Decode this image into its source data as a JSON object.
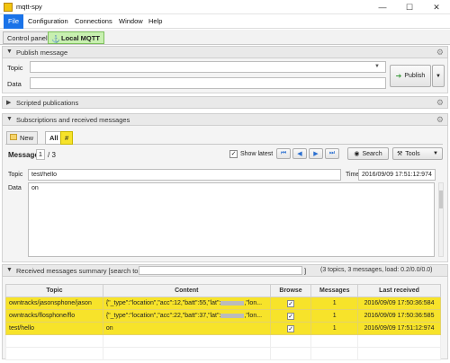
{
  "window": {
    "title": "mqtt-spy"
  },
  "menu": [
    "File",
    "Configuration",
    "Connections",
    "Window",
    "Help"
  ],
  "tabs": [
    {
      "label": "Control panel"
    },
    {
      "label": "Local MQTT"
    }
  ],
  "publish": {
    "section_title": "Publish message",
    "topic_label": "Topic",
    "data_label": "Data",
    "topic_value": "",
    "data_value": "",
    "publish_button": "Publish"
  },
  "scripted": {
    "section_title": "Scripted publications"
  },
  "subscriptions": {
    "section_title": "Subscriptions and received messages",
    "sub_tabs": [
      "New",
      "All",
      "#"
    ],
    "message_label": "Message",
    "message_index": "1",
    "message_total": "/ 3",
    "show_latest_label": "Show latest",
    "search_button": "Search",
    "tools_button": "Tools",
    "topic_label": "Topic",
    "topic_value": "test/hello",
    "time_label": "Time",
    "time_value": "2016/09/09 17:51:12:974",
    "data_label": "Data",
    "data_value": "on"
  },
  "summary": {
    "section_title": "Received messages summary [search topics:",
    "bracket_close": "]",
    "stats": "(3 topics, 3 messages, load: 0.2/0.0/0.0)",
    "columns": [
      "Topic",
      "Content",
      "Browse",
      "Messages",
      "Last received"
    ],
    "rows": [
      {
        "topic": "owntracks/jasonsphone/jason",
        "content": "{\"_type\":\"location\",\"acc\":12,\"batt\":55,\"lat\":",
        "content_tail": ",\"lon...",
        "browse": true,
        "messages": "1",
        "last": "2016/09/09 17:50:36:584"
      },
      {
        "topic": "owntracks/flosphone/flo",
        "content": "{\"_type\":\"location\",\"acc\":22,\"batt\":37,\"lat\":",
        "content_tail": ",\"lon...",
        "browse": true,
        "messages": "1",
        "last": "2016/09/09 17:50:36:585"
      },
      {
        "topic": "test/hello",
        "content": "on",
        "content_tail": "",
        "browse": true,
        "messages": "1",
        "last": "2016/09/09 17:51:12:974"
      }
    ]
  },
  "colors": {
    "accent": "#1a73e8",
    "row_highlight": "#f7e32a",
    "tab_active": "#c8f0b0"
  }
}
